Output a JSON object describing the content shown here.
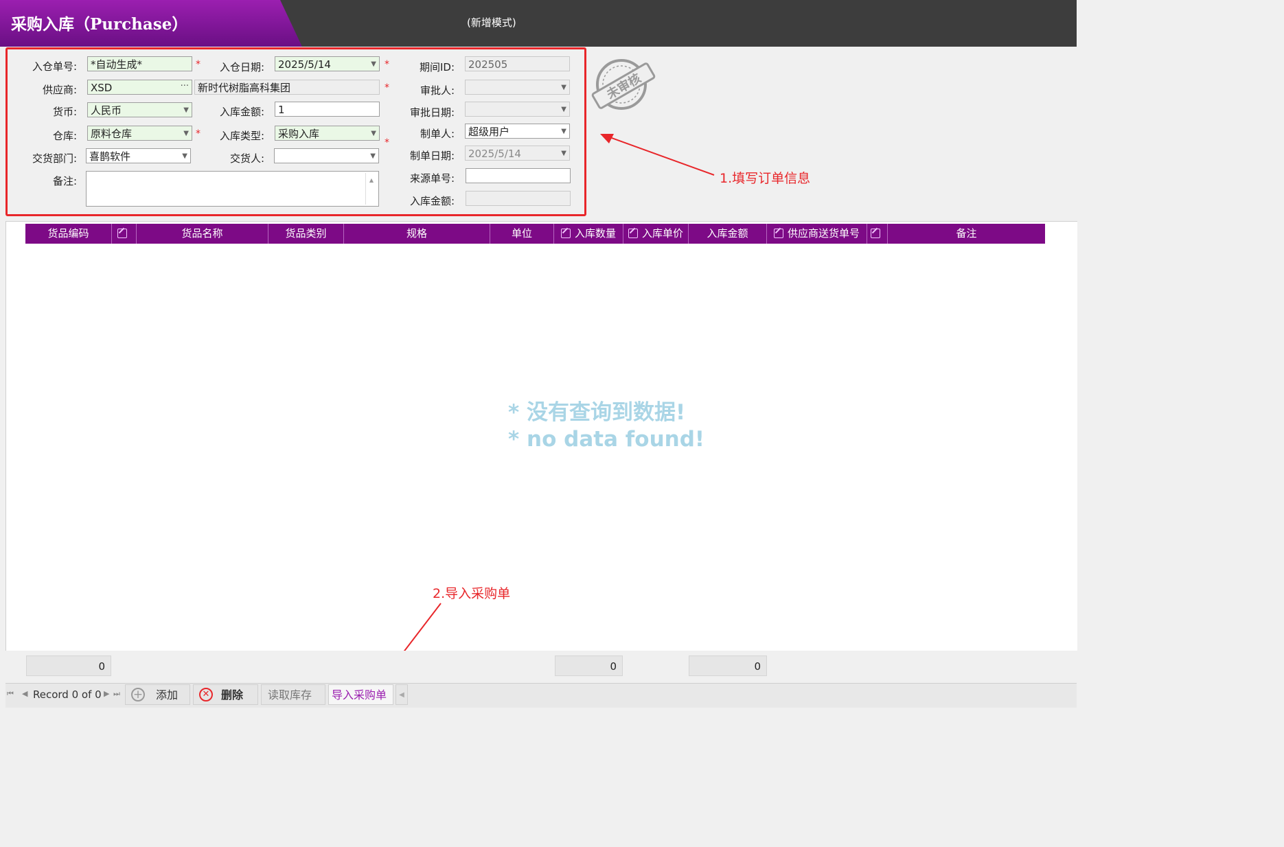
{
  "window": {
    "title": "采购入库（Purchase）",
    "mode": "(新增模式)"
  },
  "form": {
    "no_label": "入仓单号:",
    "no_value": "*自动生成*",
    "date_label": "入仓日期:",
    "date_value": "2025/5/14",
    "period_label": "期间ID:",
    "period_value": "202505",
    "supplier_label": "供应商:",
    "supplier_code": "XSD",
    "supplier_name": "新时代树脂高科集团",
    "approver_label": "审批人:",
    "approver_value": "",
    "currency_label": "货币:",
    "currency_value": "人民币",
    "amount_label": "入库金额:",
    "amount_value": "1",
    "approve_date_label": "审批日期:",
    "approve_date_value": "",
    "warehouse_label": "仓库:",
    "warehouse_value": "原料仓库",
    "type_label": "入库类型:",
    "type_value": "采购入库",
    "maker_label": "制单人:",
    "maker_value": "超级用户",
    "dept_label": "交货部门:",
    "dept_value": "喜鹊软件",
    "deliverer_label": "交货人:",
    "deliverer_value": "",
    "make_date_label": "制单日期:",
    "make_date_value": "2025/5/14",
    "remark_label": "备注:",
    "remark_value": "",
    "source_label": "来源单号:",
    "source_value": "",
    "total_label": "入库金额:",
    "total_value": "",
    "required_mark": "*"
  },
  "stamp": {
    "text": "未审核"
  },
  "annotations": {
    "step1": "1.填写订单信息",
    "step2": "2.导入采购单"
  },
  "grid": {
    "columns": [
      "货品编码",
      "",
      "货品名称",
      "货品类别",
      "规格",
      "单位",
      "入库数量",
      "入库单价",
      "入库金额",
      "供应商送货单号",
      "",
      "备注"
    ],
    "empty_cn": "* 没有查询到数据!",
    "empty_en": "* no data found!"
  },
  "summary": {
    "col1": "0",
    "qty": "0",
    "amount": "0"
  },
  "navigator": {
    "record": "Record 0 of 0",
    "add": "添加",
    "delete": "删除",
    "read_stock": "读取库存",
    "import_po": "导入采购单"
  },
  "colors": {
    "accent": "#7d0a86",
    "annotation": "#e8262a"
  }
}
